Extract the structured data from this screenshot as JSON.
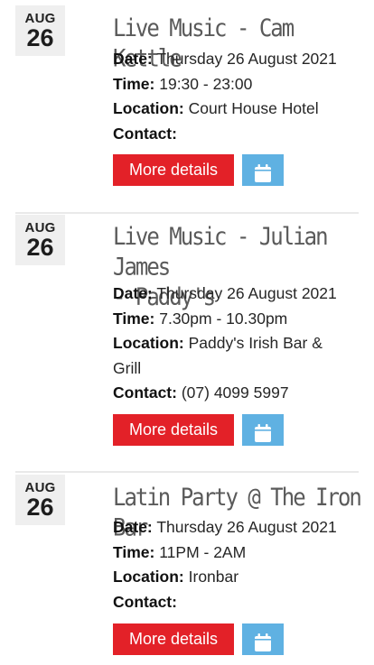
{
  "events": [
    {
      "month": "AUG",
      "day": "26",
      "title_lines": [
        "Live Music - Cam Kettle"
      ],
      "date_label": "Date:",
      "date": "Thursday 26 August 2021",
      "time_label": "Time:",
      "time": "19:30 - 23:00",
      "location_label": "Location:",
      "location": "Court House Hotel",
      "contact_label": "Contact:",
      "contact": "",
      "more_label": "More details",
      "calendar_icon": "calendar-icon"
    },
    {
      "month": "AUG",
      "day": "26",
      "title_lines": [
        "Live Music - Julian James",
        "- Paddy's"
      ],
      "date_label": "Date:",
      "date": "Thursday 26 August 2021",
      "time_label": "Time:",
      "time": "7.30pm - 10.30pm",
      "location_label": "Location:",
      "location": "Paddy's Irish Bar &",
      "location_cont": "Grill",
      "contact_label": "Contact:",
      "contact": "(07) 4099 5997",
      "more_label": "More details",
      "calendar_icon": "calendar-icon"
    },
    {
      "month": "AUG",
      "day": "26",
      "title_lines": [
        "Latin Party @ The Iron Bar"
      ],
      "date_label": "Date:",
      "date": "Thursday 26 August 2021",
      "time_label": "Time:",
      "time": "11PM - 2AM",
      "location_label": "Location:",
      "location": "Ironbar",
      "contact_label": "Contact:",
      "contact": "",
      "more_label": "More details",
      "calendar_icon": "calendar-icon"
    }
  ],
  "colors": {
    "button_red": "#e32128",
    "button_blue": "#5fb1e2",
    "badge_bg": "#efefef",
    "title_gray": "#5a5a5a"
  }
}
